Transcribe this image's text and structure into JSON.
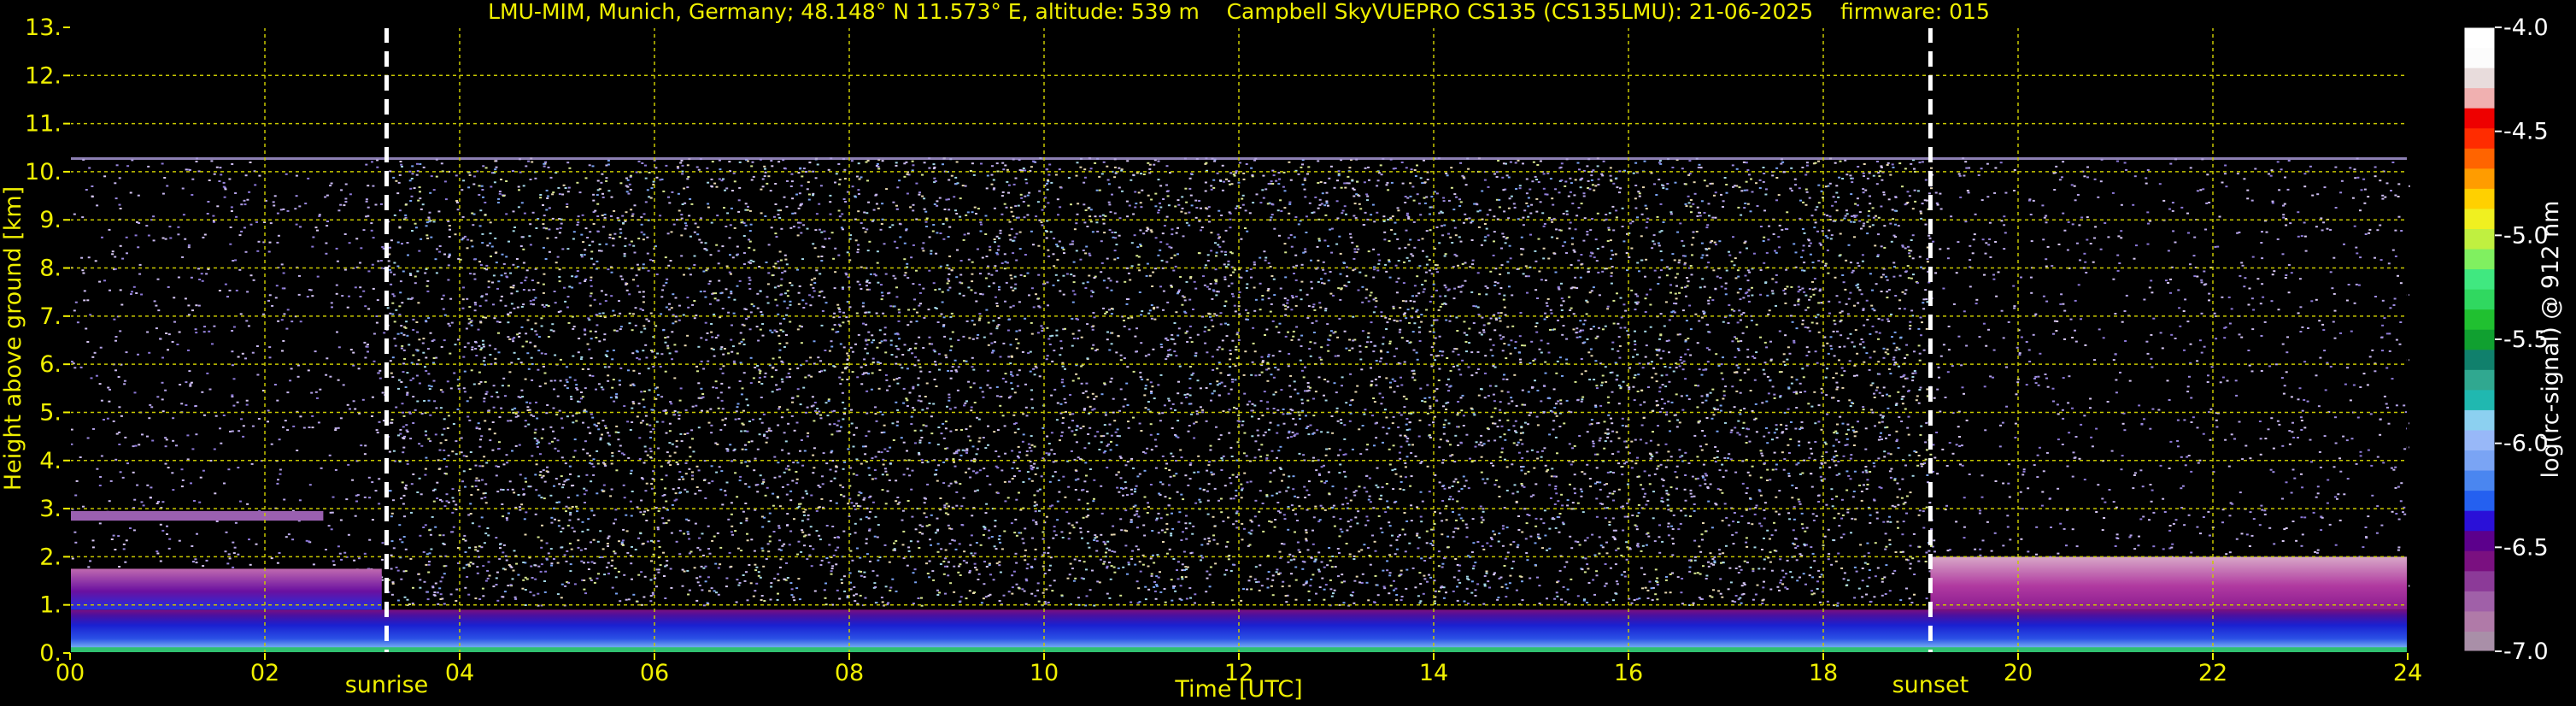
{
  "chart_data": {
    "type": "heatmap",
    "title": "LMU-MIM, Munich, Germany; 48.148° N 11.573° E, altitude: 539 m    Campbell SkyVUEPRO CS135 (CS135LMU): 21-06-2025    firmware: 015",
    "xlabel": "Time [UTC]",
    "ylabel": "Height above ground [km]",
    "xlim": [
      0,
      24
    ],
    "ylim": [
      0,
      13
    ],
    "x_ticks": [
      0,
      2,
      4,
      6,
      8,
      10,
      12,
      14,
      16,
      18,
      20,
      22,
      24
    ],
    "x_tick_labels": [
      "00",
      "02",
      "04",
      "06",
      "08",
      "10",
      "12",
      "14",
      "16",
      "18",
      "20",
      "22",
      "24"
    ],
    "y_ticks": [
      0,
      1,
      2,
      3,
      4,
      5,
      6,
      7,
      8,
      9,
      10,
      11,
      12,
      13
    ],
    "y_tick_labels": [
      "0.",
      "1.",
      "2.",
      "3.",
      "4.",
      "5.",
      "6.",
      "7.",
      "8.",
      "9.",
      "10.",
      "11.",
      "12.",
      "13."
    ],
    "grid": true,
    "data_top_km": 10.3,
    "markers": [
      {
        "label": "sunrise",
        "x": 3.25
      },
      {
        "label": "sunset",
        "x": 19.1
      }
    ],
    "colorbar": {
      "label": "log(rc-signal) @ 912 nm",
      "range": [
        -7.0,
        -4.0
      ],
      "tick_values": [
        -4.0,
        -4.5,
        -5.0,
        -5.5,
        -6.0,
        -6.5,
        -7.0
      ],
      "tick_labels": [
        "-4.0",
        "-4.5",
        "-5.0",
        "-5.5",
        "-6.0",
        "-6.5",
        "-7.0"
      ],
      "colors": [
        "#a98fa8",
        "#b07aa8",
        "#a060a8",
        "#8c3a98",
        "#7a1080",
        "#5c008c",
        "#2a10d8",
        "#2460f0",
        "#4a86f0",
        "#7aa4f4",
        "#98b8f8",
        "#8cd0f0",
        "#20b8b0",
        "#30a890",
        "#10806c",
        "#10a030",
        "#20c030",
        "#30d860",
        "#40e880",
        "#80f060",
        "#c0f040",
        "#f0f020",
        "#ffd000",
        "#ff9c00",
        "#ff6400",
        "#ff2c00",
        "#ee0000",
        "#f0b0b0",
        "#e8dcdc",
        "#fcfcfc",
        "#ffffff"
      ]
    },
    "layers": [
      {
        "name": "surface layer",
        "x": [
          0,
          24
        ],
        "bottom": 0.1,
        "top": 0.9
      },
      {
        "name": "residual layer",
        "x": [
          0,
          3.2
        ],
        "bottom": 0.9,
        "top": 1.75
      },
      {
        "name": "elevated layer",
        "x": [
          0,
          2.6
        ],
        "bottom": 2.75,
        "top": 2.95
      },
      {
        "name": "evening layer",
        "x": [
          19.1,
          24
        ],
        "bottom": 0.9,
        "top": 2.0
      }
    ]
  }
}
